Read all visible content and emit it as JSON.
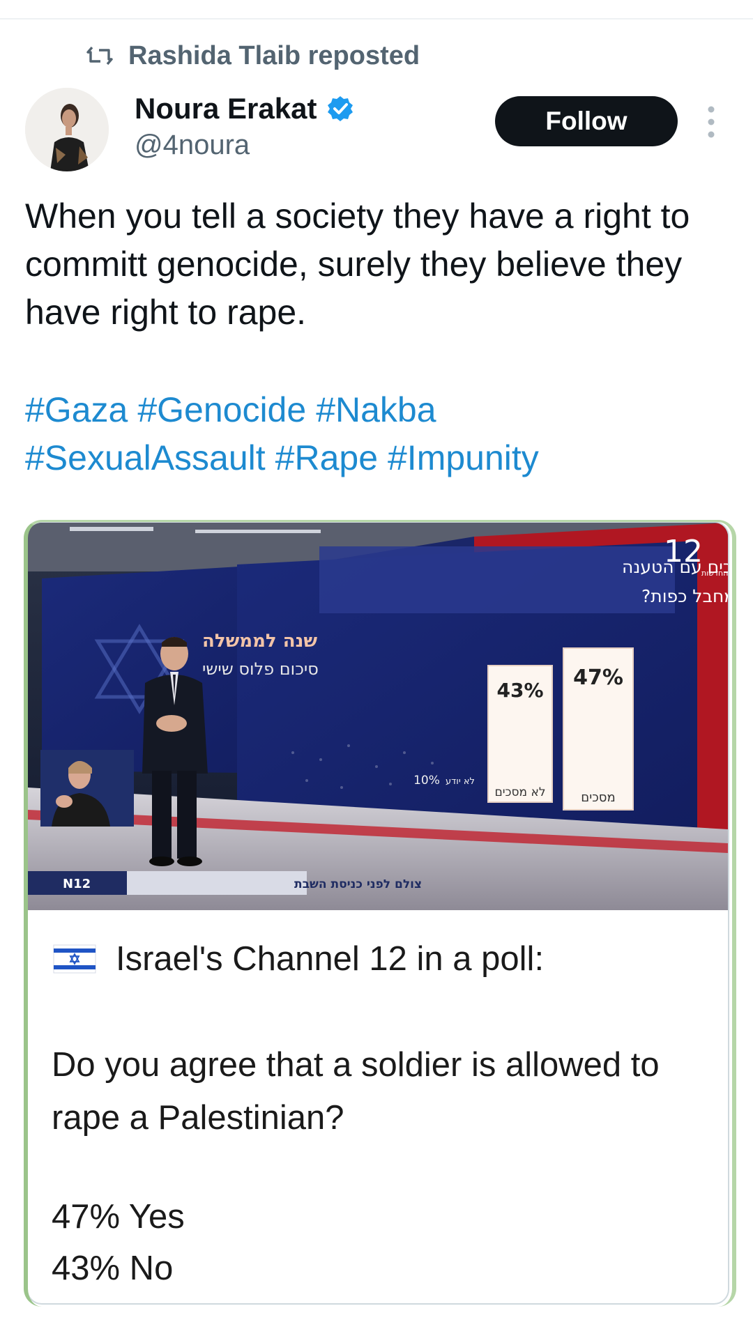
{
  "repost": {
    "icon": "repost-icon",
    "label": "Rashida Tlaib reposted"
  },
  "author": {
    "name": "Noura Erakat",
    "handle": "@4noura",
    "verified": true,
    "avatar_icon": "avatar"
  },
  "follow_label": "Follow",
  "more_icon": "more-vertical-icon",
  "tweet": {
    "text": "When you tell a society they have a right to committ genocide, surely they believe they have right to rape.",
    "hashtags": [
      "#Gaza",
      "#Genocide",
      "#Nakba",
      "#SexualAssault",
      "#Rape",
      "#Impunity"
    ]
  },
  "quote": {
    "image": {
      "channel_logo": "12",
      "channel_sub": "החדשות",
      "question_line1": "האם אתה מסכים עם הטענה",
      "question_line2": "שלחייל מותר לאנוס מחבל כפות?",
      "bars": [
        {
          "label": "מסכים",
          "value": "47%"
        },
        {
          "label": "לא מסכים",
          "value": "43%"
        },
        {
          "label": "לא יודע",
          "value": "10%"
        }
      ],
      "studio_sign_line1": "שנה לממשלה",
      "studio_sign_line2": "סיכום פלוס שישי",
      "ticker_logo": "N12",
      "ticker_text": "צולם לפני כניסת השבת"
    },
    "flag_icon": "israel-flag-icon",
    "caption": "Israel's Channel 12 in a poll:",
    "question": "Do you agree that a soldier is allowed to rape a Palestinian?",
    "yes": "47% Yes",
    "no": "43% No"
  },
  "colors": {
    "hashtag": "#1d8ad0",
    "follow_bg": "#0f1419",
    "verified": "#1d9bf0",
    "secondary": "#536471"
  }
}
